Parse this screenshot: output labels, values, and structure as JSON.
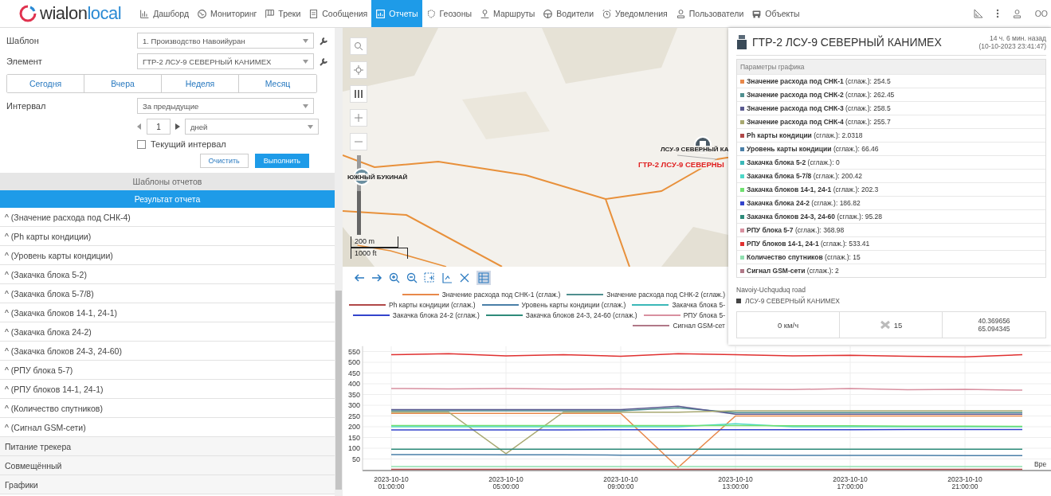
{
  "logo": {
    "name": "wialon",
    "suffix": "local"
  },
  "nav": [
    {
      "label": "Дашборд",
      "selected": false
    },
    {
      "label": "Мониторинг",
      "selected": false
    },
    {
      "label": "Треки",
      "selected": false
    },
    {
      "label": "Сообщения",
      "selected": false
    },
    {
      "label": "Отчеты",
      "selected": true
    },
    {
      "label": "Геозоны",
      "selected": false
    },
    {
      "label": "Маршруты",
      "selected": false
    },
    {
      "label": "Водители",
      "selected": false
    },
    {
      "label": "Уведомления",
      "selected": false
    },
    {
      "label": "Пользователи",
      "selected": false
    },
    {
      "label": "Объекты",
      "selected": false
    }
  ],
  "user": {
    "name": "ОО"
  },
  "form": {
    "template_label": "Шаблон",
    "template": "1. Производство Навоийуран",
    "element_label": "Элемент",
    "element": "ГТР-2 ЛСУ-9 СЕВЕРНЫЙ КАНИМЕХ",
    "periods": [
      {
        "label": "Сегодня",
        "selected": false
      },
      {
        "label": "Вчера",
        "selected": false
      },
      {
        "label": "Неделя",
        "selected": false
      },
      {
        "label": "Месяц",
        "selected": false
      }
    ],
    "interval_label": "Интервал",
    "interval": "За предыдущие",
    "count": "1",
    "unit": "дней",
    "current_interval": {
      "label": "Текущий интервал",
      "checked": false
    },
    "buttons": [
      "Очистить",
      "Выполнить"
    ]
  },
  "templates_header": "Шаблоны отчетов",
  "result_header": "Результат отчета",
  "results": [
    "^ (Значение расхода под СНК-4)",
    "^ (Ph карты кондиции)",
    "^ (Уровень карты кондиции)",
    "^ (Закачка блока 5-2)",
    "^ (Закачка блока 5-7/8)",
    "^ (Закачка блоков 14-1, 24-1)",
    "^ (Закачка блока 24-2)",
    "^ (Закачка блоков 24-3, 24-60)",
    "^ (РПУ блока 5-7)",
    "^ (РПУ блоков 14-1, 24-1)",
    "^ (Количество спутников)",
    "^ (Сигнал GSM-сети)",
    "Питание трекера",
    "Совмещённый",
    "Графики"
  ],
  "map": {
    "labels": [
      {
        "text": "ЮЖНЫЙ БУКИНАЙ",
        "kind": "plain"
      },
      {
        "text": "ЛСУ-9 СЕВЕРНЫЙ КА",
        "kind": "plain"
      },
      {
        "text": "ГТР-2 ЛСУ-9 СЕВЕРНЫ",
        "kind": "alert"
      }
    ],
    "scale": [
      "200 m",
      "1000 ft"
    ],
    "zoom": {
      "level": 0.55
    }
  },
  "popup": {
    "title": "ГТР-2 ЛСУ-9 СЕВЕРНЫЙ КАНИМЕХ",
    "ago": "14 ч. 6 мин. назад",
    "time": "(10-10-2023 23:41:47)",
    "params_header": "Параметры графика",
    "params": [
      {
        "text": "**Значение расхода под СНК-1** (сглаж.): 254.5",
        "color": "#e8884a"
      },
      {
        "text": "**Значение расхода под СНК-2** (сглаж.): 262.45",
        "color": "#4f8f8f"
      },
      {
        "text": "**Значение расхода под СНК-3** (сглаж.): 258.5",
        "color": "#5a5a90"
      },
      {
        "text": "**Значение расхода под СНК-4** (сглаж.): 255.7",
        "color": "#a8a870"
      },
      {
        "text": "**Ph карты кондиции** (сглаж.): 2.0318",
        "color": "#b04848"
      },
      {
        "text": "**Уровень карты кондиции** (сглаж.): 66.46",
        "color": "#4a7fa8"
      },
      {
        "text": "**Закачка блока 5-2** (сглаж.): 0",
        "color": "#3bb8b8"
      },
      {
        "text": "**Закачка блока 5-7/8** (сглаж.): 200.42",
        "color": "#4dd8c8"
      },
      {
        "text": "**Закачка блоков 14-1, 24-1** (сглаж.): 202.3",
        "color": "#70e070"
      },
      {
        "text": "**Закачка блока 24-2** (сглаж.): 186.82",
        "color": "#3344cc"
      },
      {
        "text": "**Закачка блоков 24-3, 24-60** (сглаж.): 95.28",
        "color": "#2e8b7a"
      },
      {
        "text": "**РПУ блока 5-7** (сглаж.): 368.98",
        "color": "#d890a0"
      },
      {
        "text": "**РПУ блоков 14-1, 24-1** (сглаж.): 533.41",
        "color": "#e03030"
      },
      {
        "text": "**Количество спутников** (сглаж.): 15",
        "color": "#90e0b0"
      },
      {
        "text": "**Сигнал GSM-сети** (сглаж.): 2",
        "color": "#b07888"
      }
    ],
    "address": "Navoiy-Uchquduq road",
    "unit": "ЛСУ-9 СЕВЕРНЫЙ КАНИМЕХ",
    "speed": "0 км/ч",
    "satellites": "15",
    "lat": "40.369656",
    "lon": "65.094345"
  },
  "legend": [
    [
      {
        "text": "Значение расхода под СНК-1 (сглаж.)",
        "color": "#e8884a"
      },
      {
        "text": "Значение расхода под СНК-2 (сглаж.)",
        "color": "#4f8f8f"
      }
    ],
    [
      {
        "text": "Ph карты кондиции (сглаж.)",
        "color": "#b04848"
      },
      {
        "text": "Уровень карты кондиции (сглаж.)",
        "color": "#4a7fa8"
      },
      {
        "text": "Закачка блока 5-",
        "color": "#3bb8b8"
      }
    ],
    [
      {
        "text": "Закачка блока 24-2 (сглаж.)",
        "color": "#3344cc"
      },
      {
        "text": "Закачка блоков 24-3, 24-60 (сглаж.)",
        "color": "#2e8b7a"
      },
      {
        "text": "РПУ блока 5-",
        "color": "#d890a0"
      }
    ],
    [
      {
        "text": "Сигнал GSM-сет",
        "color": "#b07888"
      }
    ]
  ],
  "chart_data": {
    "type": "line",
    "xlabel": "Вре",
    "categories": [
      "2023-10-10 01:00:00",
      null,
      "2023-10-10 05:00:00",
      null,
      "2023-10-10 09:00:00",
      null,
      "2023-10-10 13:00:00",
      null,
      "2023-10-10 17:00:00",
      null,
      "2023-10-10 21:00:00",
      null
    ],
    "grid": true,
    "ylim": [
      0,
      575
    ],
    "yticks": [
      50,
      100,
      150,
      200,
      250,
      300,
      350,
      400,
      450,
      500,
      550
    ],
    "series": [
      {
        "color": "#e8884a",
        "values": [
          262,
          262,
          262,
          262,
          262,
          10,
          250,
          250,
          250,
          250,
          250,
          250
        ]
      },
      {
        "color": "#4f8f8f",
        "values": [
          274,
          274,
          274,
          274,
          274,
          288,
          266,
          266,
          266,
          266,
          266,
          266
        ]
      },
      {
        "color": "#5a5a90",
        "values": [
          280,
          280,
          280,
          280,
          280,
          295,
          258,
          258,
          258,
          258,
          258,
          258
        ]
      },
      {
        "color": "#a8a870",
        "values": [
          268,
          268,
          75,
          268,
          268,
          268,
          274,
          274,
          274,
          274,
          274,
          274
        ]
      },
      {
        "color": "#b04848",
        "values": [
          2,
          2,
          2,
          2,
          2,
          2,
          2,
          2,
          2,
          2,
          2,
          2
        ]
      },
      {
        "color": "#4a7fa8",
        "values": [
          70,
          70,
          69,
          69,
          68,
          68,
          68,
          67,
          67,
          67,
          66,
          66
        ]
      },
      {
        "color": "#4dd8c8",
        "values": [
          200,
          200,
          200,
          200,
          200,
          200,
          214,
          200,
          200,
          200,
          200,
          200
        ]
      },
      {
        "color": "#70e070",
        "values": [
          206,
          206,
          206,
          206,
          206,
          206,
          206,
          205,
          205,
          203,
          203,
          202
        ]
      },
      {
        "color": "#3344cc",
        "values": [
          185,
          185,
          185,
          185,
          186,
          186,
          186,
          186,
          186,
          187,
          187,
          187
        ]
      },
      {
        "color": "#2e8b7a",
        "values": [
          95,
          95,
          95,
          95,
          95,
          95,
          95,
          95,
          95,
          95,
          95,
          95
        ]
      },
      {
        "color": "#d890a0",
        "values": [
          378,
          376,
          378,
          375,
          376,
          374,
          375,
          373,
          378,
          372,
          374,
          370
        ]
      },
      {
        "color": "#e03030",
        "values": [
          535,
          540,
          530,
          535,
          528,
          540,
          535,
          530,
          532,
          528,
          525,
          535
        ]
      },
      {
        "color": "#90e0b0",
        "values": [
          15,
          15,
          15,
          15,
          15,
          15,
          15,
          15,
          15,
          15,
          15,
          15
        ]
      }
    ]
  }
}
